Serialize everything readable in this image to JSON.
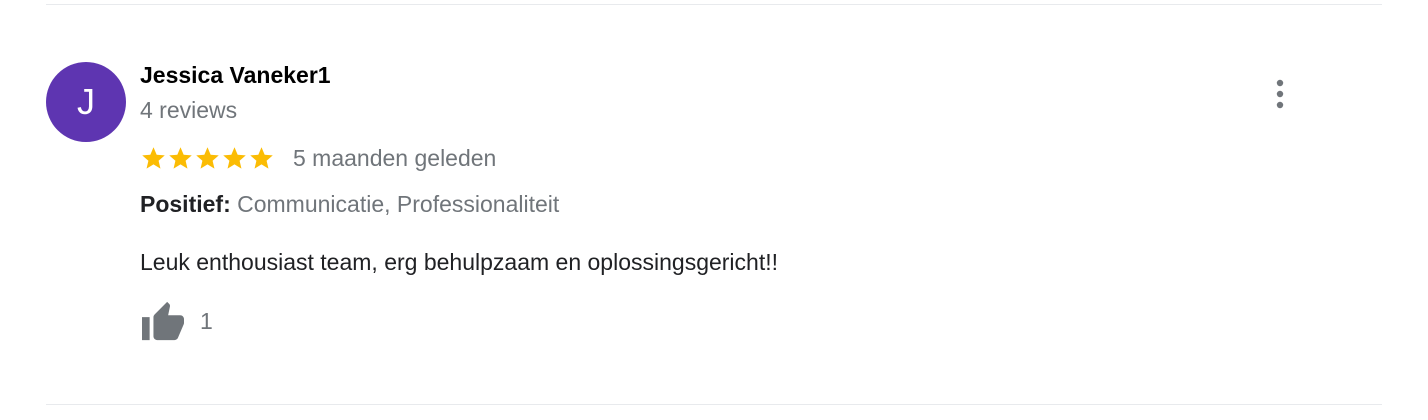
{
  "review": {
    "author_initial": "J",
    "author_name": "Jessica Vaneker1",
    "review_count": "4 reviews",
    "rating": 5,
    "rating_max": 5,
    "time_ago": "5 maanden geleden",
    "attributes_label": "Positief:",
    "attributes_value": "Communicatie, Professionaliteit",
    "text": "Leuk enthousiast team, erg behulpzaam en oplossingsgericht!!",
    "like_count": "1"
  },
  "icons": {
    "more": "more-vert-icon",
    "star": "star-icon",
    "like": "thumbs-up-icon"
  },
  "colors": {
    "avatar_bg": "#5e35b1",
    "star": "#fbbc04",
    "muted_text": "#70757a",
    "icon_gray": "#70757a",
    "divider": "#e8eaed"
  }
}
